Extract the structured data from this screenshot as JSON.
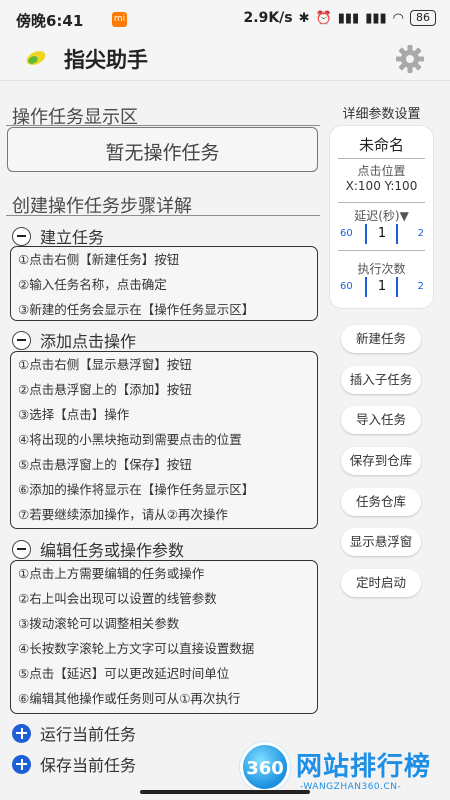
{
  "status_bar": {
    "time": "傍晚6:41",
    "mi_badge": "mi",
    "net_speed": "2.9K/s",
    "battery": "86"
  },
  "app": {
    "title": "指尖助手",
    "logo_icon": "app-logo-icon",
    "settings_icon": "gear-icon"
  },
  "display_section": {
    "title": "操作任务显示区",
    "empty_text": "暂无操作任务"
  },
  "guide": {
    "title": "创建操作任务步骤详解",
    "sections": [
      {
        "label": "建立任务",
        "items": [
          "①点击右侧【新建任务】按钮",
          "②输入任务名称，点击确定",
          "③新建的任务会显示在【操作任务显示区】"
        ]
      },
      {
        "label": "添加点击操作",
        "items": [
          "①点击右侧【显示悬浮窗】按钮",
          "②点击悬浮窗上的【添加】按钮",
          "③选择【点击】操作",
          "④将出现的小黑块拖动到需要点击的位置",
          "⑤点击悬浮窗上的【保存】按钮",
          "⑥添加的操作将显示在【操作任务显示区】",
          "⑦若要继续添加操作，请从②再次操作"
        ]
      },
      {
        "label": "编辑任务或操作参数",
        "items": [
          "①点击上方需要编辑的任务或操作",
          "②右上叫会出现可以设置的线管参数",
          "③拨动滚轮可以调整相关参数",
          "④长按数字滚轮上方文字可以直接设置数据",
          "⑤点击【延迟】可以更改延迟时间单位",
          "⑥编辑其他操作或任务则可从①再次执行"
        ]
      }
    ],
    "collapsed": [
      {
        "label": "运行当前任务"
      },
      {
        "label": "保存当前任务"
      }
    ]
  },
  "params": {
    "title": "详细参数设置",
    "name": "未命名",
    "click_pos_label": "点击位置",
    "click_pos_value": "X:100  Y:100",
    "delay_label": "延迟(秒)▼",
    "delay": {
      "low": "60",
      "value": "1",
      "high": "2"
    },
    "repeat_label": "执行次数",
    "repeat": {
      "low": "60",
      "value": "1",
      "high": "2"
    }
  },
  "actions": [
    "新建任务",
    "插入子任务",
    "导入任务",
    "保存到仓库",
    "任务仓库",
    "显示悬浮窗",
    "定时启动"
  ],
  "watermark": {
    "badge": "360",
    "text": "网站排行榜",
    "sub": "-WANGZHAN360.CN-"
  },
  "colors": {
    "accent": "#1c5fd8",
    "watermark": "#1e8fe6",
    "background": "#f3f3f3"
  }
}
